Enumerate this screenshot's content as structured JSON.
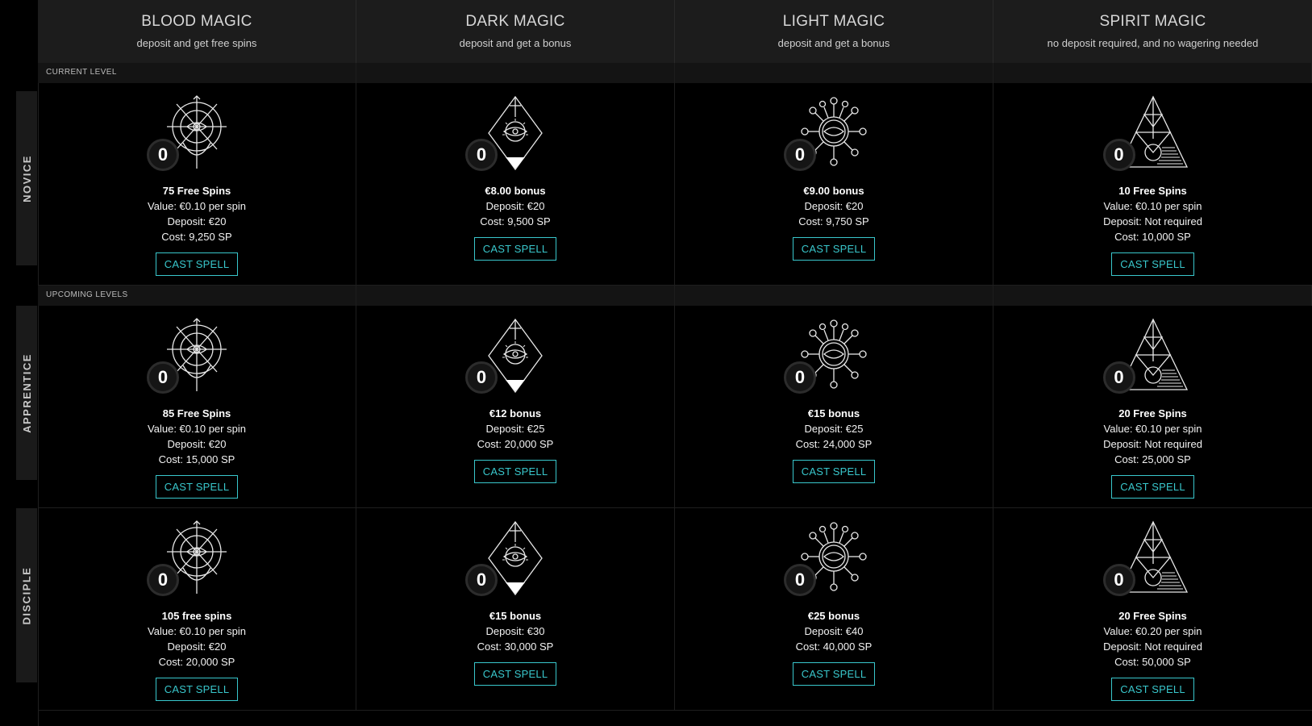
{
  "columns": [
    {
      "title": "BLOOD MAGIC",
      "subtitle": "deposit and get free spins"
    },
    {
      "title": "DARK MAGIC",
      "subtitle": "deposit and get a bonus"
    },
    {
      "title": "LIGHT MAGIC",
      "subtitle": "deposit and get a bonus"
    },
    {
      "title": "SPIRIT MAGIC",
      "subtitle": "no deposit required, and no wagering needed"
    }
  ],
  "sections": {
    "current": "CURRENT LEVEL",
    "upcoming": "UPCOMING LEVELS"
  },
  "levels": [
    {
      "name": "NOVICE",
      "cards": [
        {
          "count": "0",
          "lines": [
            "75 Free Spins",
            "Value: €0.10 per spin",
            "Deposit: €20",
            "Cost: 9,250 SP"
          ],
          "button": "CAST SPELL"
        },
        {
          "count": "0",
          "lines": [
            "€8.00 bonus",
            "Deposit: €20",
            "Cost: 9,500 SP"
          ],
          "button": "CAST SPELL"
        },
        {
          "count": "0",
          "lines": [
            "€9.00 bonus",
            "Deposit: €20",
            "Cost: 9,750 SP"
          ],
          "button": "CAST SPELL"
        },
        {
          "count": "0",
          "lines": [
            "10 Free Spins",
            "Value: €0.10 per spin",
            "Deposit: Not required",
            "Cost: 10,000 SP"
          ],
          "button": "CAST SPELL"
        }
      ]
    },
    {
      "name": "APPRENTICE",
      "cards": [
        {
          "count": "0",
          "lines": [
            "85 Free Spins",
            "Value: €0.10 per spin",
            "Deposit: €20",
            "Cost: 15,000 SP"
          ],
          "button": "CAST SPELL"
        },
        {
          "count": "0",
          "lines": [
            "€12 bonus",
            "Deposit: €25",
            "Cost: 20,000 SP"
          ],
          "button": "CAST SPELL"
        },
        {
          "count": "0",
          "lines": [
            "€15 bonus",
            "Deposit: €25",
            "Cost: 24,000 SP"
          ],
          "button": "CAST SPELL"
        },
        {
          "count": "0",
          "lines": [
            "20 Free Spins",
            "Value: €0.10 per spin",
            "Deposit: Not required",
            "Cost: 25,000 SP"
          ],
          "button": "CAST SPELL"
        }
      ]
    },
    {
      "name": "DISCIPLE",
      "cards": [
        {
          "count": "0",
          "lines": [
            "105 free spins",
            "Value: €0.10 per spin",
            "Deposit: €20",
            "Cost: 20,000 SP"
          ],
          "button": "CAST SPELL"
        },
        {
          "count": "0",
          "lines": [
            "€15 bonus",
            "Deposit: €30",
            "Cost: 30,000 SP"
          ],
          "button": "CAST SPELL"
        },
        {
          "count": "0",
          "lines": [
            "€25 bonus",
            "Deposit: €40",
            "Cost: 40,000 SP"
          ],
          "button": "CAST SPELL"
        },
        {
          "count": "0",
          "lines": [
            "20 Free Spins",
            "Value: €0.20 per spin",
            "Deposit: Not required",
            "Cost: 50,000 SP"
          ],
          "button": "CAST SPELL"
        }
      ]
    }
  ],
  "icons": [
    "blood-magic-sigil-icon",
    "dark-magic-diamond-icon",
    "light-magic-sun-icon",
    "spirit-magic-pyramid-icon"
  ],
  "colors": {
    "accent": "#39c7cc",
    "background": "#000000",
    "header": "#1c1c1c"
  }
}
